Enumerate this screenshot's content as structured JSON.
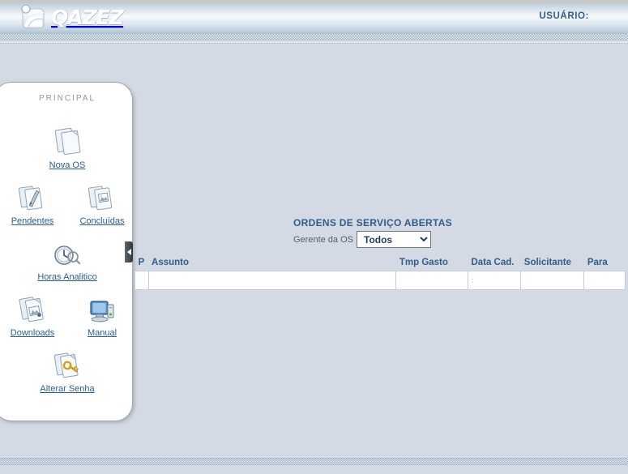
{
  "header": {
    "logo_text": "QAZEZ",
    "logo_icon": "person-photo-logo-icon",
    "user_label": "USUÁRIO:"
  },
  "sidebar": {
    "title": "PRINCIPAL",
    "collapse_icon": "collapse-left-arrow-icon",
    "items": [
      {
        "label": "Nova OS",
        "icon": "new-document-icon"
      },
      {
        "label": "Pendentes",
        "icon": "clipboard-pen-icon"
      },
      {
        "label": "Concluídas",
        "icon": "clipboard-check-icon"
      },
      {
        "label": "Horas Analitico",
        "icon": "clock-search-icon"
      },
      {
        "label": "Downloads",
        "icon": "document-image-icon"
      },
      {
        "label": "Manual",
        "icon": "computer-monitor-icon"
      },
      {
        "label": "Alterar Senha",
        "icon": "document-key-icon"
      }
    ]
  },
  "main": {
    "title": "ORDENS DE SERVIÇO ABERTAS",
    "filter": {
      "label": "Gerente da OS",
      "selected": "Todos",
      "options": [
        "Todos"
      ]
    },
    "table": {
      "columns": [
        "P",
        "Assunto",
        "Tmp Gasto",
        "Data Cad.",
        "Solicitante",
        "Para"
      ],
      "rows": [
        {
          "p": "",
          "assunto": "",
          "tmp_gasto": "",
          "data_cad": "",
          "solicitante": "",
          "para": ""
        }
      ],
      "empty_cell_marker": ":"
    }
  },
  "colors": {
    "page_background": "#d4dae3",
    "accent_blue": "#2f5d8c",
    "link_blue": "#2a5d96",
    "panel_white": "#ffffff",
    "header_gradient_top": "#b9cbd9",
    "header_gradient_mid": "#eef3f7",
    "header_gradient_bottom": "#b2c4d3",
    "dither_band": "#9fb3c6"
  }
}
